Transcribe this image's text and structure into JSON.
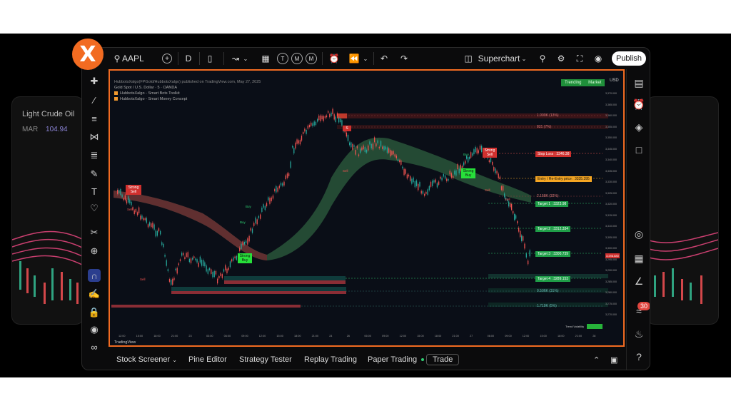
{
  "side_cards": {
    "left_title": "Light Crude Oil",
    "left_sub_label": "MAR",
    "left_sub_value": "104.94"
  },
  "topbar": {
    "symbol": "AAPL",
    "timeframe": "D",
    "quick_1": "T",
    "quick_2": "M",
    "quick_3": "M",
    "layout_name": "Superchart",
    "publish_label": "Publish"
  },
  "chart": {
    "legend_line_0": "HubbotsXalgo(FPGold/HubbotsXalgo) published on TradingView.com, May 27, 2025",
    "legend_line_1": "Gold Spot / U.S. Dollar · 5 · OANDA",
    "legend_line_2": "HubbotsXalgo - Smart Bots Toolkit",
    "legend_line_3": "HubbotsXalgo - Smart Money Concept",
    "trending_label": "Trending",
    "market_label": "Market",
    "currency": "USD",
    "tradingview_label": "TradingView",
    "price_axis": [
      "3,370.000",
      "3,365.000",
      "3,360.000",
      "3,355.000",
      "3,350.000",
      "3,345.000",
      "3,340.000",
      "3,335.000",
      "3,330.000",
      "3,325.000",
      "3,320.000",
      "3,315.000",
      "3,310.000",
      "3,305.000",
      "3,300.000",
      "3,295.000",
      "3,290.000",
      "3,285.000",
      "3,280.000",
      "3,275.000",
      "3,270.000"
    ],
    "time_axis": [
      "12:00",
      "15:00",
      "18:00",
      "21:00",
      "23",
      "03:00",
      "06:00",
      "09:00",
      "12:00",
      "15:00",
      "18:00",
      "21:00",
      "24",
      "26",
      "06:00",
      "09:00",
      "12:00",
      "15:00",
      "18:00",
      "21:00",
      "27",
      "06:00",
      "09:00",
      "12:00",
      "15:00",
      "18:00",
      "21:00",
      "28"
    ],
    "levels": {
      "l1": "1.000K (13%)",
      "l2": "821 (7%)",
      "sl": "Stop Loss : 3346.38",
      "entry": "Entry / Re-Entry price : 3335.395",
      "l3": "2.158K (32%)",
      "t1": "Target 1 : 3323.98",
      "t2": "Target 2 : 3312.334",
      "t3": "Target 3 : 3300.739",
      "t4": "Target 4 : 3289.153",
      "l4": "0.506K (31%)",
      "l5": "1.719K (5%)"
    },
    "signals": {
      "strong_sell_1": "Strong Sell",
      "strong_buy_1": "Strong Buy",
      "strong_buy_2": "Strong Buy",
      "strong_sell_2": "Strong Sell",
      "s": "S"
    },
    "small_labels": {
      "buy": "Buy",
      "sell": "Sell",
      "trend_volatility": "Trend Volatility",
      "current_price": "3,298.680"
    }
  },
  "bottombar": {
    "stock_screener": "Stock Screener",
    "pine_editor": "Pine Editor",
    "strategy_tester": "Strategy Tester",
    "replay_trading": "Replay Trading",
    "paper_trading": "Paper Trading",
    "trade": "Trade"
  },
  "notifications_count": "30",
  "colors": {
    "accent_orange": "#f26b21",
    "up": "#26a69a",
    "down": "#ef5350"
  }
}
